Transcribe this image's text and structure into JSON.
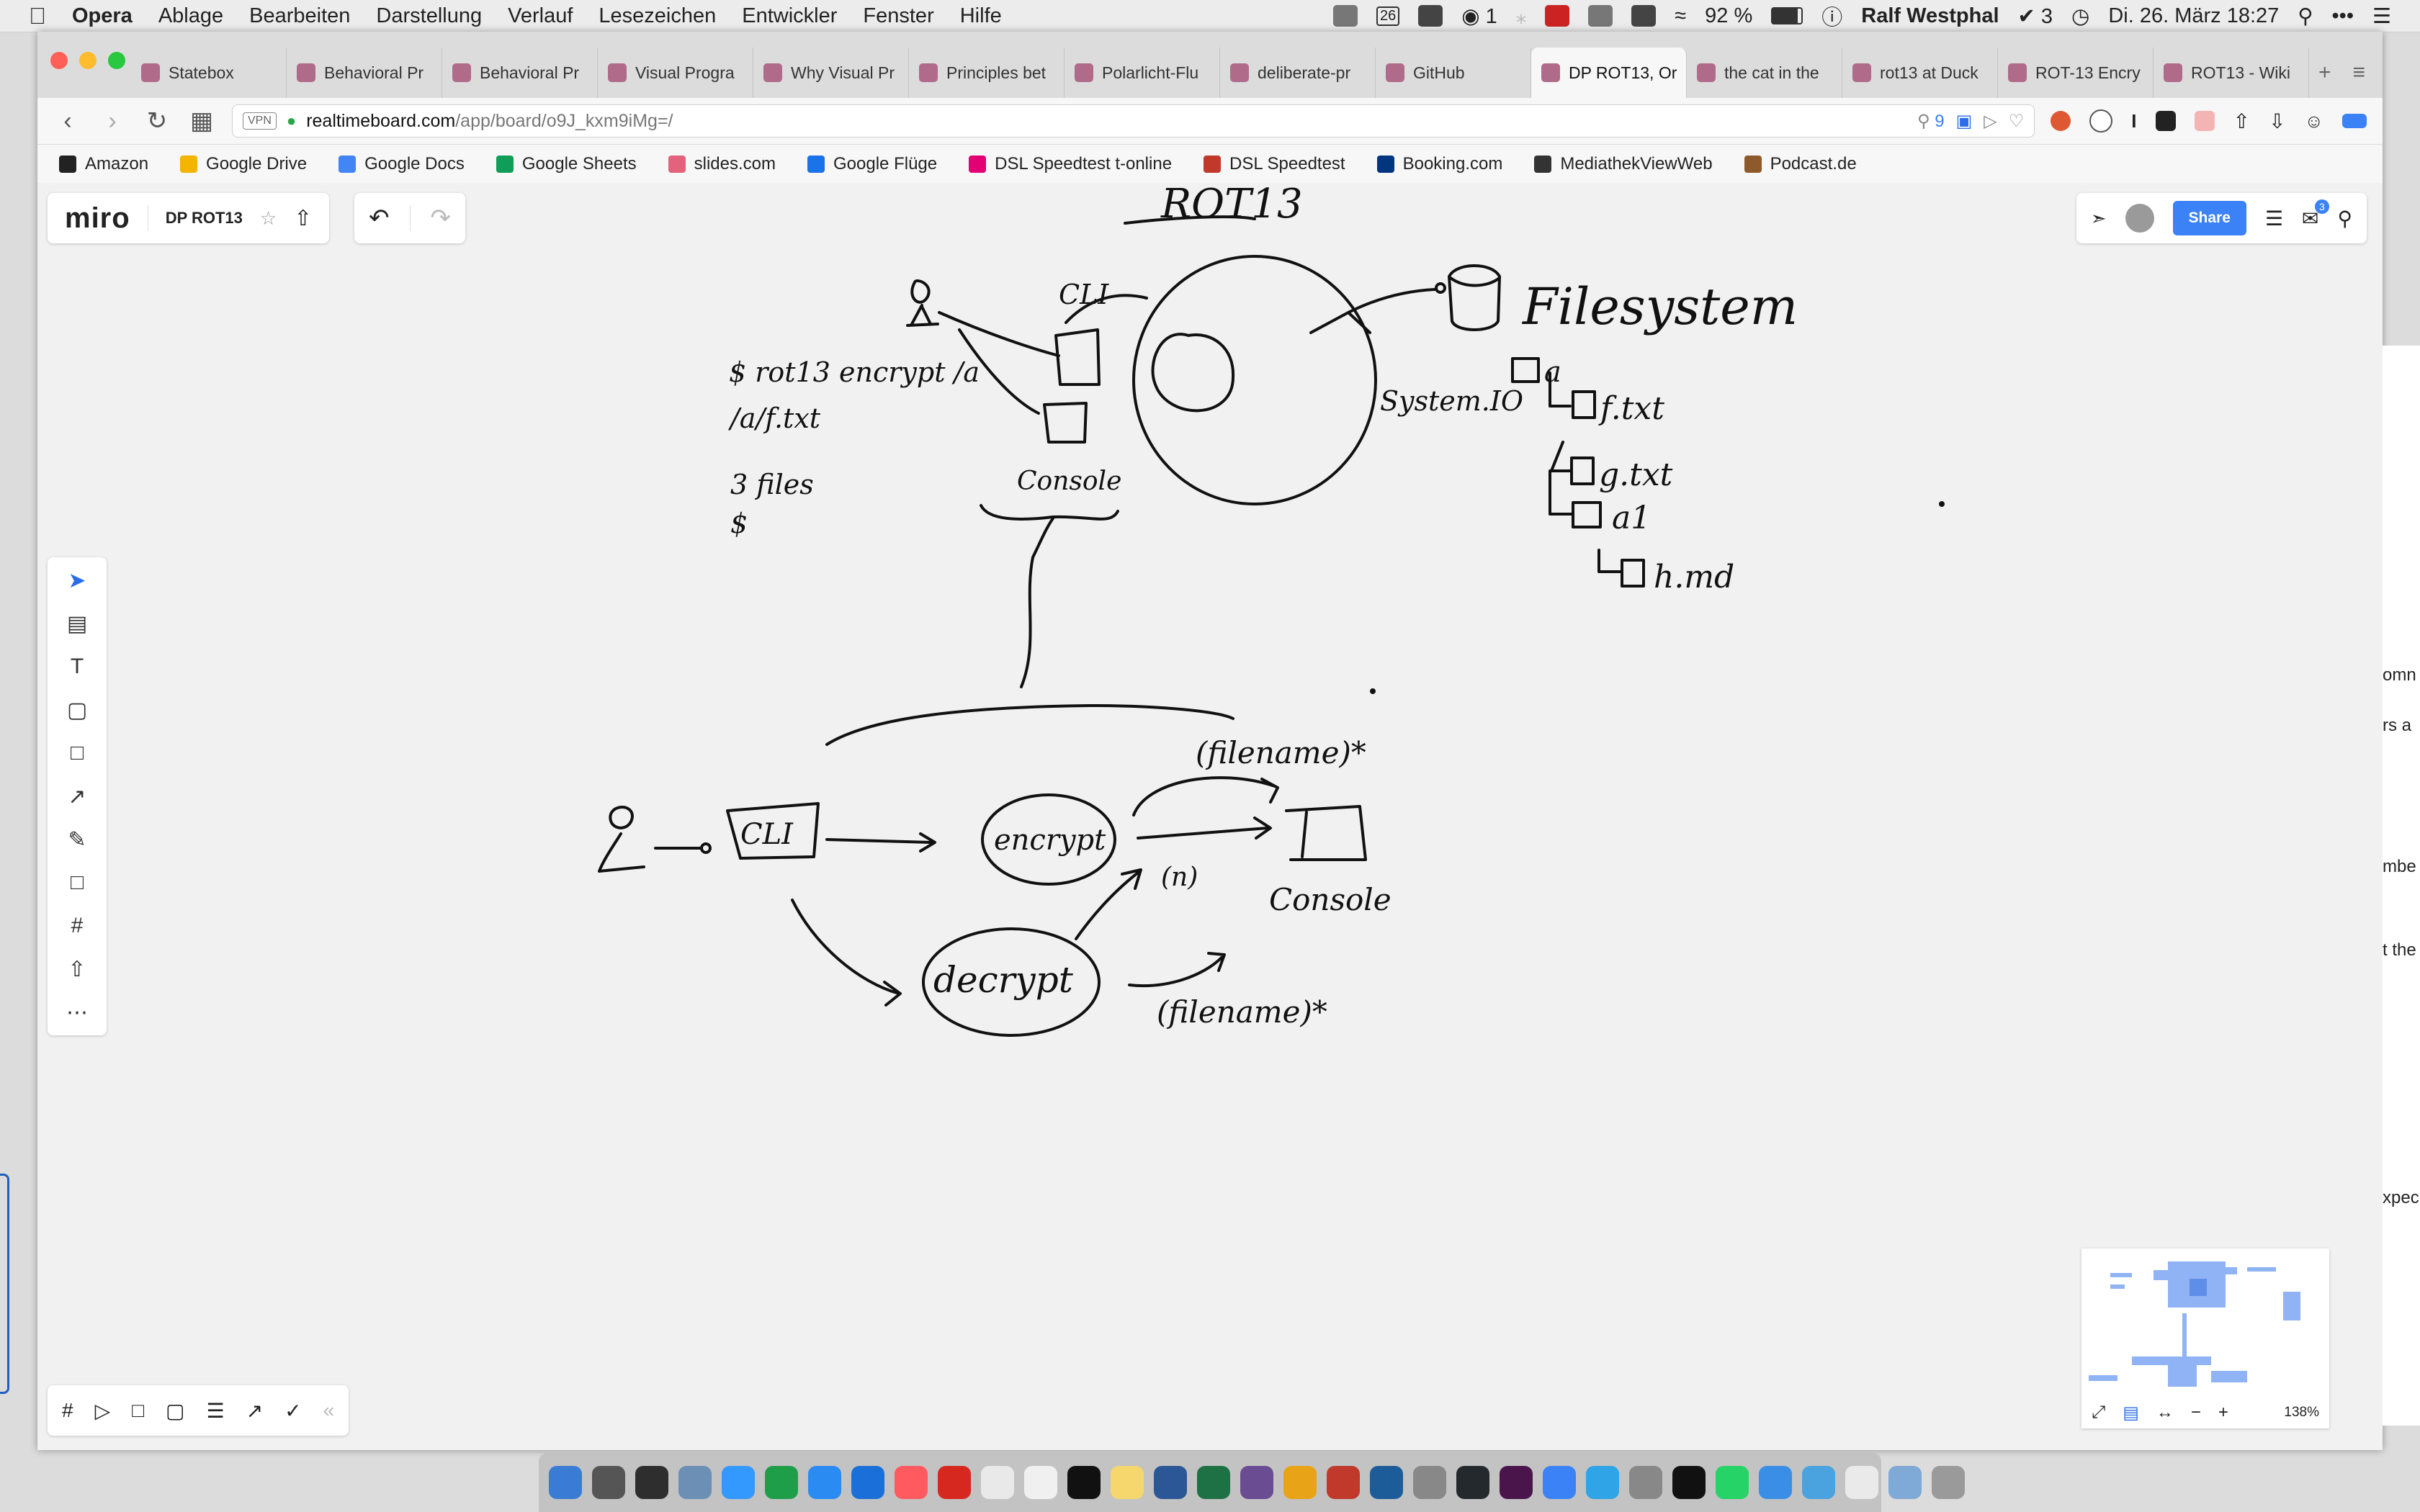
{
  "menubar": {
    "app_name": "Opera",
    "menus": [
      "Ablage",
      "Bearbeiten",
      "Darstellung",
      "Verlauf",
      "Lesezeichen",
      "Entwickler",
      "Fenster",
      "Hilfe"
    ],
    "calendar_day": "26",
    "onepassword_count": "1",
    "battery": "92 %",
    "user_name": "Ralf Westphal",
    "tasks_count": "3",
    "datetime": "Di. 26. März  18:27"
  },
  "browser": {
    "tabs": [
      {
        "label": "Statebox",
        "active": false
      },
      {
        "label": "Behavioral Pr",
        "active": false
      },
      {
        "label": "Behavioral Pr",
        "active": false
      },
      {
        "label": "Visual Progra",
        "active": false
      },
      {
        "label": "Why Visual Pr",
        "active": false
      },
      {
        "label": "Principles bet",
        "active": false
      },
      {
        "label": "Polarlicht-Flu",
        "active": false
      },
      {
        "label": "deliberate-pr",
        "active": false
      },
      {
        "label": "GitHub",
        "active": false
      },
      {
        "label": "DP ROT13, Or",
        "active": true
      },
      {
        "label": "the cat in the",
        "active": false
      },
      {
        "label": "rot13 at Duck",
        "active": false
      },
      {
        "label": "ROT-13 Encry",
        "active": false
      },
      {
        "label": "ROT13 - Wiki",
        "active": false
      }
    ],
    "url_host": "realtimeboard.com",
    "url_path": "/app/board/o9J_kxm9iMg=/",
    "vpn_label": "VPN",
    "search_count": "9",
    "bookmarks": [
      {
        "label": "Amazon",
        "color": "#222222"
      },
      {
        "label": "Google Drive",
        "color": "#f4b400"
      },
      {
        "label": "Google Docs",
        "color": "#4285f4"
      },
      {
        "label": "Google Sheets",
        "color": "#0f9d58"
      },
      {
        "label": "slides.com",
        "color": "#e4637c"
      },
      {
        "label": "Google Flüge",
        "color": "#1a73e8"
      },
      {
        "label": "DSL Speedtest t-online",
        "color": "#e20074"
      },
      {
        "label": "DSL Speedtest",
        "color": "#c0392b"
      },
      {
        "label": "Booking.com",
        "color": "#003580"
      },
      {
        "label": "MediathekViewWeb",
        "color": "#333333"
      },
      {
        "label": "Podcast.de",
        "color": "#8e5a2b"
      }
    ]
  },
  "miro": {
    "logo": "miro",
    "board_name": "DP ROT13",
    "share_label": "Share",
    "notification_count": "3",
    "zoom": "138%",
    "accent": "#3b82f6"
  },
  "sketch": {
    "title": "ROT13",
    "cli_label": "CLI",
    "console_label": "Console",
    "filesystem_label": "Filesystem",
    "systemio_label": "System.IO",
    "cmd_line1": "$ rot13 encrypt /a",
    "cmd_line2": "/a/f.txt",
    "cmd_line3": "3 files",
    "cmd_line4": "$",
    "tree_root": "a",
    "tree_items": [
      "f.txt",
      "g.txt",
      "a1",
      "h.md"
    ],
    "flow_cli": "CLI",
    "flow_encrypt": "encrypt",
    "flow_decrypt": "decrypt",
    "flow_console": "Console",
    "flow_filename_top": "(filename)*",
    "flow_n": "(n)",
    "flow_filename_bottom": "(filename)*"
  },
  "peek": {
    "lines": [
      "omn",
      "rs a",
      "mbe",
      "t the",
      "xpec"
    ]
  }
}
